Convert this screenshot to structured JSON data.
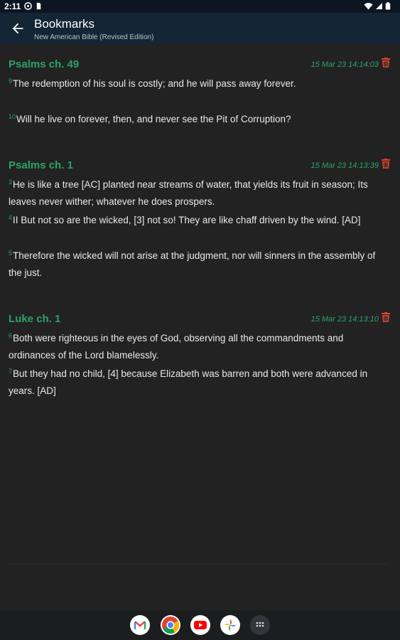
{
  "status_bar": {
    "time": "2:11"
  },
  "app_bar": {
    "title": "Bookmarks",
    "subtitle": "New American Bible (Revised Edition)"
  },
  "bookmarks": [
    {
      "title": "Psalms ch. 49",
      "date": "15 Mar 23 14:14:03",
      "verses": [
        {
          "num": "9",
          "text": "The redemption of his soul is costly; and he will pass away forever."
        },
        {
          "num": "10",
          "text": "Will he live on forever, then, and never see the Pit of Corruption?"
        }
      ]
    },
    {
      "title": "Psalms ch. 1",
      "date": "15 Mar 23 14:13:39",
      "verses": [
        {
          "num": "3",
          "text": "He is like a tree [AC] planted near streams of water, that yields its fruit in season; Its leaves never wither; whatever he does prospers."
        },
        {
          "num": "4",
          "text": "II But not so are the wicked, [3] not so! They are like chaff driven by the wind. [AD]"
        },
        {
          "num": "5",
          "text": "Therefore the wicked will not arise at the judgment, nor will sinners in the assembly of the just."
        }
      ]
    },
    {
      "title": "Luke ch. 1",
      "date": "15 Mar 23 14:13:10",
      "verses": [
        {
          "num": "6",
          "text": "Both were righteous in the eyes of God, observing all the commandments and ordinances of the Lord blamelessly."
        },
        {
          "num": "7",
          "text": "But they had no child, [4] because Elizabeth was barren and both were advanced in years. [AD]"
        }
      ]
    }
  ],
  "nav_apps": [
    "gmail-icon",
    "chrome-icon",
    "youtube-icon",
    "photos-icon",
    "app-drawer-icon"
  ],
  "colors": {
    "accent": "#2aa368",
    "delete": "#d9442c",
    "background": "#222222",
    "app_bar": "#142535"
  }
}
